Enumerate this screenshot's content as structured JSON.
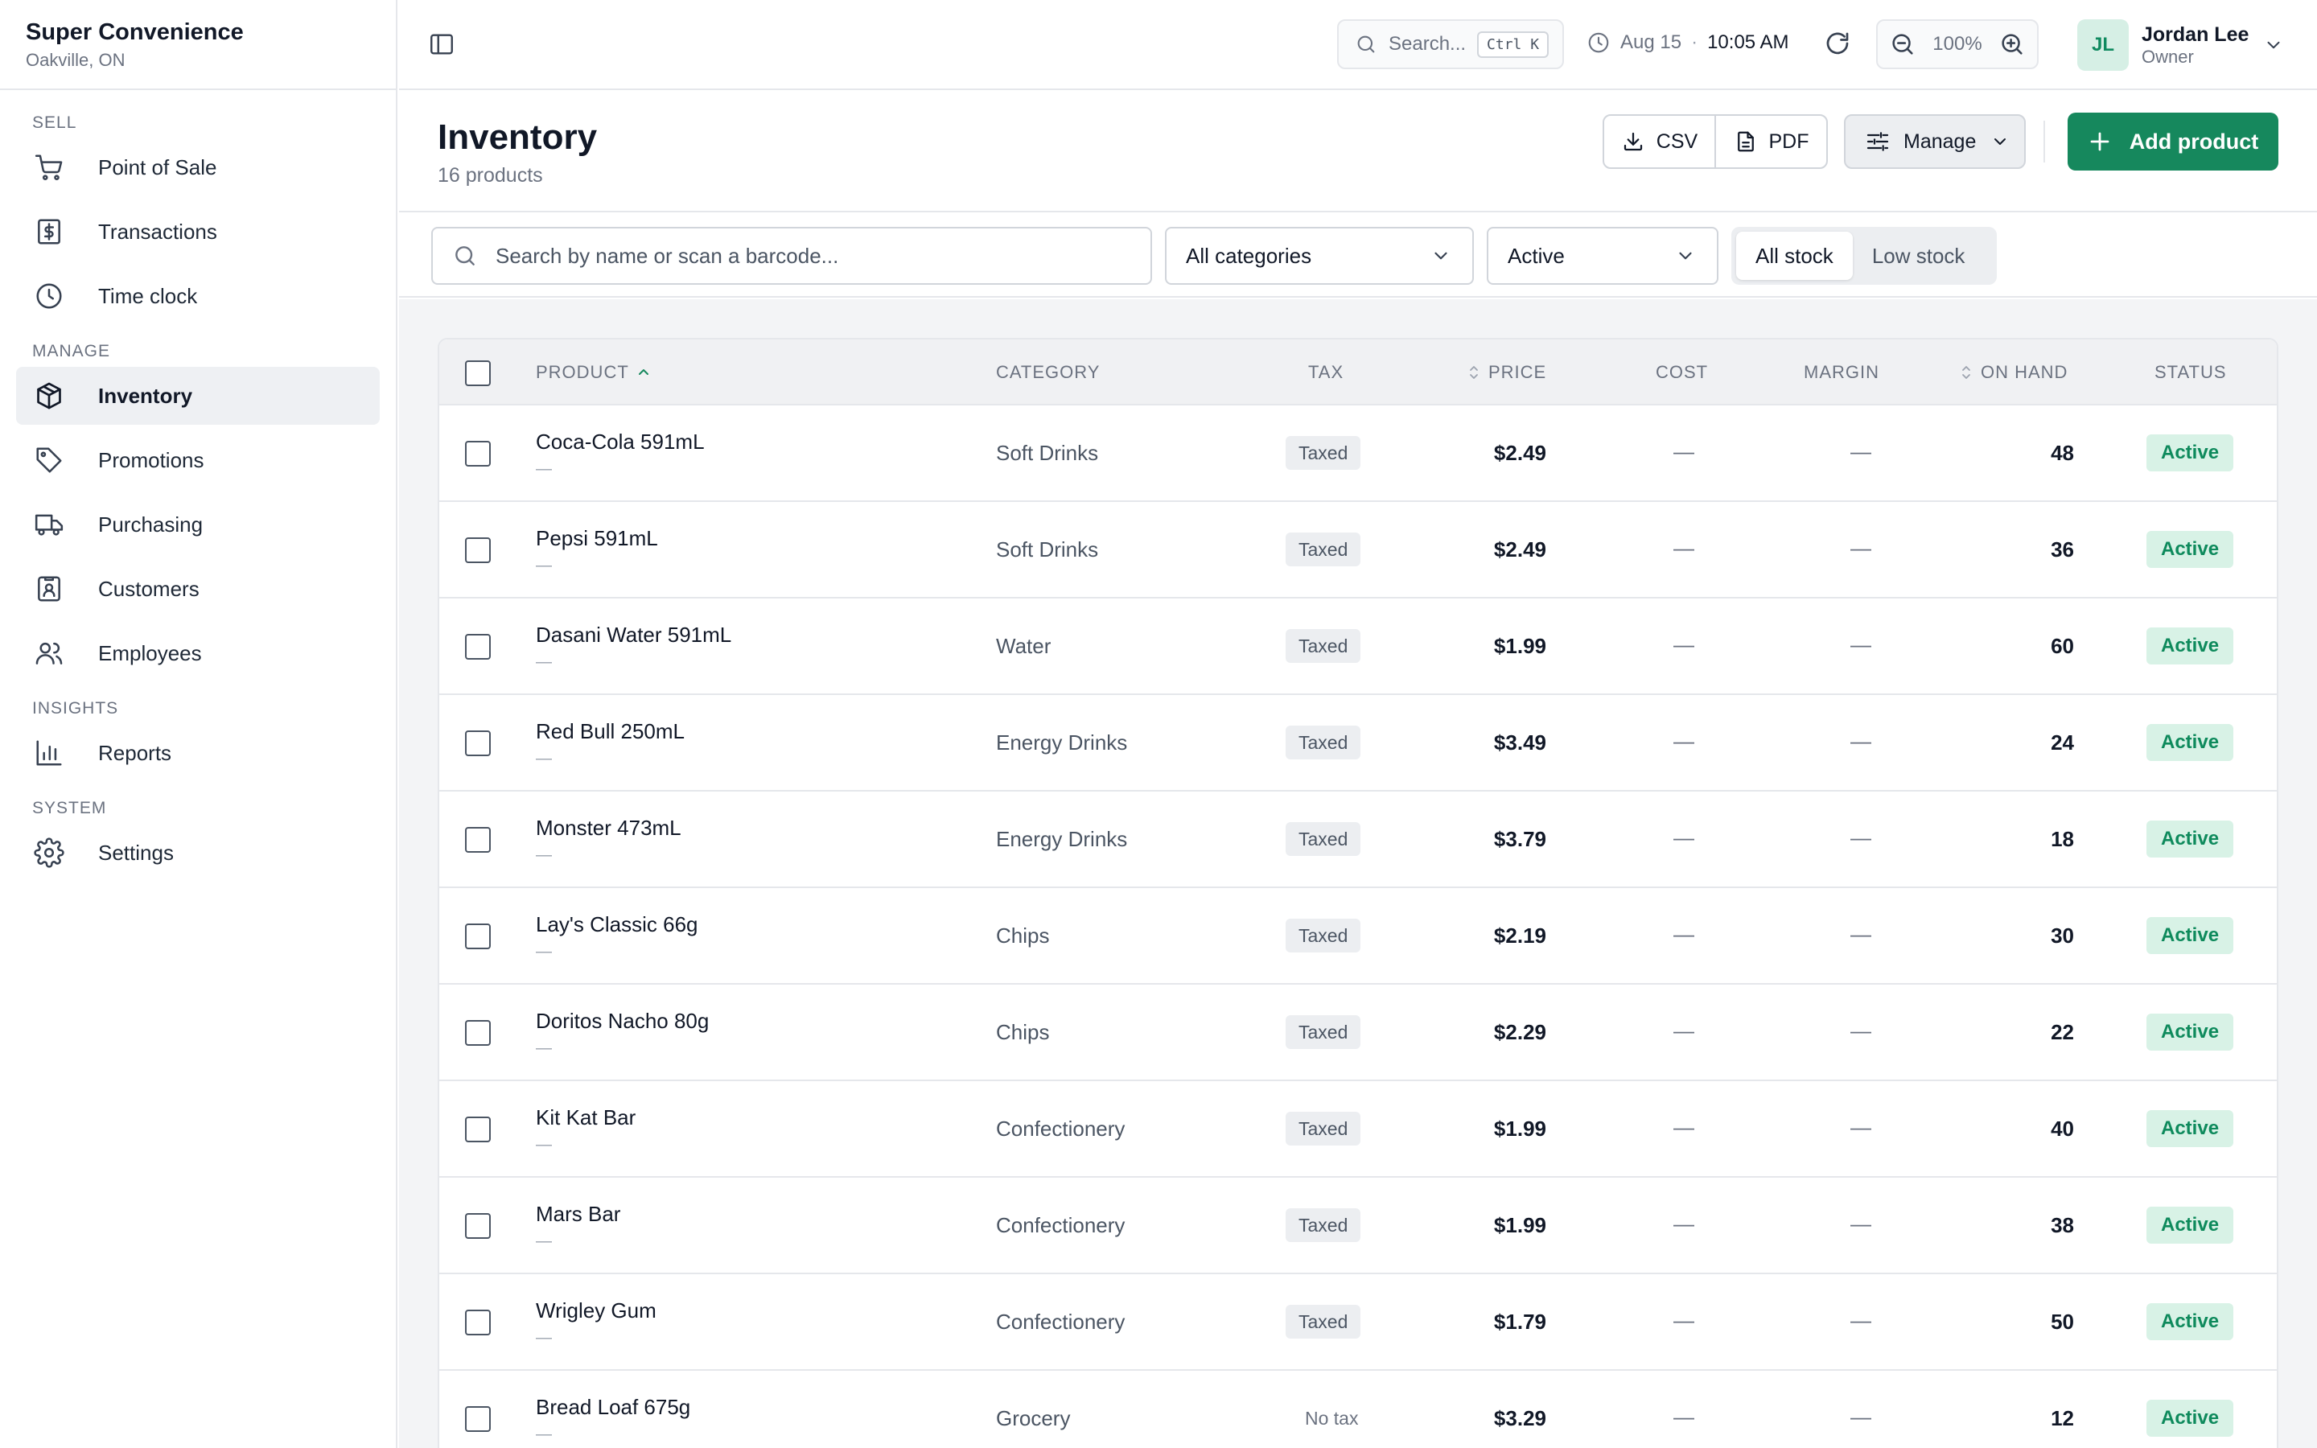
{
  "brand": {
    "name": "Super Convenience",
    "location": "Oakville, ON"
  },
  "nav": {
    "sections": [
      {
        "title": "SELL",
        "items": [
          {
            "label": "Point of Sale",
            "icon": "cart-icon"
          },
          {
            "label": "Transactions",
            "icon": "receipt-dollar-icon"
          },
          {
            "label": "Time clock",
            "icon": "clock-icon"
          }
        ]
      },
      {
        "title": "MANAGE",
        "items": [
          {
            "label": "Inventory",
            "icon": "box-icon",
            "active": true
          },
          {
            "label": "Promotions",
            "icon": "tag-icon"
          },
          {
            "label": "Purchasing",
            "icon": "truck-icon"
          },
          {
            "label": "Customers",
            "icon": "id-card-icon"
          },
          {
            "label": "Employees",
            "icon": "users-icon"
          }
        ]
      },
      {
        "title": "INSIGHTS",
        "items": [
          {
            "label": "Reports",
            "icon": "bar-chart-icon"
          }
        ]
      },
      {
        "title": "SYSTEM",
        "items": [
          {
            "label": "Settings",
            "icon": "gear-icon"
          }
        ]
      }
    ]
  },
  "topbar": {
    "search_placeholder": "Search...",
    "search_shortcut": "Ctrl K",
    "date": "Aug 15",
    "separator": "·",
    "time": "10:05 AM",
    "zoom": "100%",
    "user": {
      "initials": "JL",
      "name": "Jordan Lee",
      "role": "Owner"
    }
  },
  "page": {
    "title": "Inventory",
    "subtitle": "16 products",
    "csv_label": "CSV",
    "pdf_label": "PDF",
    "manage_label": "Manage",
    "add_label": "Add product"
  },
  "filters": {
    "search_placeholder": "Search by name or scan a barcode...",
    "category": "All categories",
    "status": "Active",
    "stock_options": [
      "All stock",
      "Low stock"
    ],
    "stock_selected": "All stock"
  },
  "table": {
    "columns": [
      "PRODUCT",
      "CATEGORY",
      "TAX",
      "PRICE",
      "COST",
      "MARGIN",
      "ON HAND",
      "STATUS"
    ],
    "sort": {
      "column": "PRODUCT",
      "direction": "ascending"
    },
    "rows": [
      {
        "name": "Coca-Cola 591mL",
        "sku": "—",
        "category": "Soft Drinks",
        "tax": "Taxed",
        "price": "$2.49",
        "cost": "—",
        "margin": "—",
        "on_hand": "48",
        "status": "Active"
      },
      {
        "name": "Pepsi 591mL",
        "sku": "—",
        "category": "Soft Drinks",
        "tax": "Taxed",
        "price": "$2.49",
        "cost": "—",
        "margin": "—",
        "on_hand": "36",
        "status": "Active"
      },
      {
        "name": "Dasani Water 591mL",
        "sku": "—",
        "category": "Water",
        "tax": "Taxed",
        "price": "$1.99",
        "cost": "—",
        "margin": "—",
        "on_hand": "60",
        "status": "Active"
      },
      {
        "name": "Red Bull 250mL",
        "sku": "—",
        "category": "Energy Drinks",
        "tax": "Taxed",
        "price": "$3.49",
        "cost": "—",
        "margin": "—",
        "on_hand": "24",
        "status": "Active"
      },
      {
        "name": "Monster 473mL",
        "sku": "—",
        "category": "Energy Drinks",
        "tax": "Taxed",
        "price": "$3.79",
        "cost": "—",
        "margin": "—",
        "on_hand": "18",
        "status": "Active"
      },
      {
        "name": "Lay's Classic 66g",
        "sku": "—",
        "category": "Chips",
        "tax": "Taxed",
        "price": "$2.19",
        "cost": "—",
        "margin": "—",
        "on_hand": "30",
        "status": "Active"
      },
      {
        "name": "Doritos Nacho 80g",
        "sku": "—",
        "category": "Chips",
        "tax": "Taxed",
        "price": "$2.29",
        "cost": "—",
        "margin": "—",
        "on_hand": "22",
        "status": "Active"
      },
      {
        "name": "Kit Kat Bar",
        "sku": "—",
        "category": "Confectionery",
        "tax": "Taxed",
        "price": "$1.99",
        "cost": "—",
        "margin": "—",
        "on_hand": "40",
        "status": "Active"
      },
      {
        "name": "Mars Bar",
        "sku": "—",
        "category": "Confectionery",
        "tax": "Taxed",
        "price": "$1.99",
        "cost": "—",
        "margin": "—",
        "on_hand": "38",
        "status": "Active"
      },
      {
        "name": "Wrigley Gum",
        "sku": "—",
        "category": "Confectionery",
        "tax": "Taxed",
        "price": "$1.79",
        "cost": "—",
        "margin": "—",
        "on_hand": "50",
        "status": "Active"
      },
      {
        "name": "Bread Loaf 675g",
        "sku": "—",
        "category": "Grocery",
        "tax": "No tax",
        "price": "$3.29",
        "cost": "—",
        "margin": "—",
        "on_hand": "12",
        "status": "Active"
      }
    ]
  },
  "colors": {
    "accent": "#16885d",
    "status_active_bg": "#d8f2e6",
    "status_active_text": "#0e8a5c",
    "avatar_bg": "#d6efe5"
  }
}
